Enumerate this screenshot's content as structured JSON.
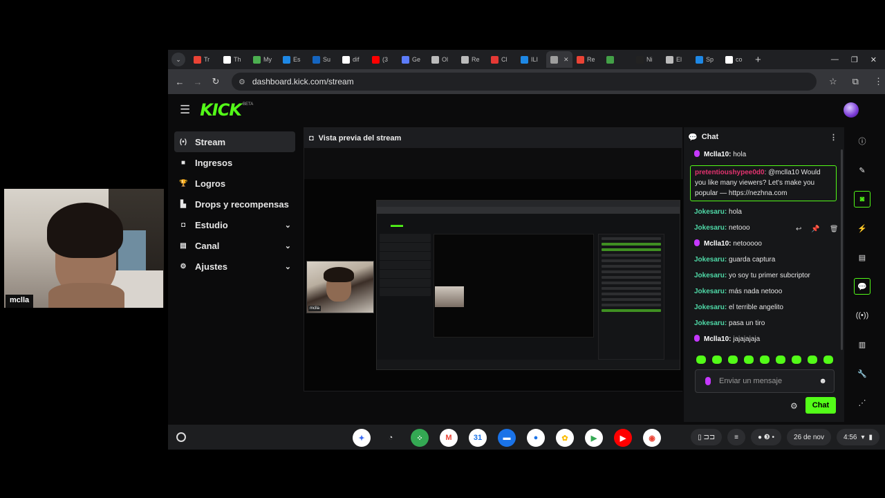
{
  "browser": {
    "tabs": [
      {
        "label": "Tr",
        "color": "#ea4335"
      },
      {
        "label": "Th",
        "color": "#ffffff"
      },
      {
        "label": "My",
        "color": "#4caf50"
      },
      {
        "label": "Es",
        "color": "#1e88e5"
      },
      {
        "label": "Su",
        "color": "#1565c0"
      },
      {
        "label": "dif",
        "color": "#ffffff"
      },
      {
        "label": "(3",
        "color": "#ff0000"
      },
      {
        "label": "Ge",
        "color": "#5c7cfa"
      },
      {
        "label": "Ol",
        "color": "#bbbbbb"
      },
      {
        "label": "Re",
        "color": "#bbbbbb"
      },
      {
        "label": "Cl",
        "color": "#e53935"
      },
      {
        "label": "ILI",
        "color": "#1e88e5"
      },
      {
        "label": "",
        "color": "#9e9e9e",
        "active": true
      },
      {
        "label": "Re",
        "color": "#ea4335"
      },
      {
        "label": "",
        "color": "#43a047"
      },
      {
        "label": "Ni",
        "color": "#222222"
      },
      {
        "label": "El",
        "color": "#bbbbbb"
      },
      {
        "label": "Sp",
        "color": "#1e88e5"
      },
      {
        "label": "co",
        "color": "#ffffff"
      }
    ],
    "url": "dashboard.kick.com/stream"
  },
  "kick": {
    "logo": "KICK",
    "beta": "BETA",
    "sidebar": [
      {
        "label": "Stream",
        "icon": "broadcast-icon",
        "glyph": "(•)",
        "active": true,
        "expandable": false
      },
      {
        "label": "Ingresos",
        "icon": "money-icon",
        "glyph": "■",
        "active": false,
        "expandable": false
      },
      {
        "label": "Logros",
        "icon": "trophy-icon",
        "glyph": "🏆",
        "active": false,
        "expandable": false
      },
      {
        "label": "Drops y recompensas",
        "icon": "drops-icon",
        "glyph": "▙",
        "active": false,
        "expandable": false
      },
      {
        "label": "Estudio",
        "icon": "studio-icon",
        "glyph": "◘",
        "active": false,
        "expandable": true
      },
      {
        "label": "Canal",
        "icon": "channel-icon",
        "glyph": "▤",
        "active": false,
        "expandable": true
      },
      {
        "label": "Ajustes",
        "icon": "settings-icon",
        "glyph": "⚙",
        "active": false,
        "expandable": true
      }
    ],
    "preview_title": "Vista previa del stream",
    "chat": {
      "title": "Chat",
      "messages": [
        {
          "user": "Mclla10:",
          "text": " hola",
          "color": "#ffffff",
          "mic": true
        },
        {
          "user": "pretentioushypee0d0",
          "text": ": @mclla10 Would you like many viewers? Let's make you popular — https://nezhna.com",
          "color": "#e3336f",
          "highlight": true
        },
        {
          "user": "Jokesaru:",
          "text": " hola",
          "color": "#4fd9a7"
        },
        {
          "user": "Jokesaru:",
          "text": " netooo",
          "color": "#4fd9a7"
        },
        {
          "user": "Mclla10:",
          "text": " netooooo",
          "color": "#ffffff",
          "mic": true
        },
        {
          "user": "Jokesaru:",
          "text": " guarda captura",
          "color": "#4fd9a7"
        },
        {
          "user": "Jokesaru:",
          "text": " yo soy tu primer subcriptor",
          "color": "#4fd9a7"
        },
        {
          "user": "Jokesaru:",
          "text": " más nada netooo",
          "color": "#4fd9a7"
        },
        {
          "user": "Jokesaru:",
          "text": " el terrible angelito",
          "color": "#4fd9a7"
        },
        {
          "user": "Jokesaru:",
          "text": " pasa un tiro",
          "color": "#4fd9a7"
        },
        {
          "user": "Mclla10:",
          "text": " jajajajaja",
          "color": "#ffffff",
          "mic": true
        }
      ],
      "input_placeholder": "Enviar un mensaje",
      "send_label": "Chat"
    },
    "rail_icons": [
      "info-icon",
      "edit-icon",
      "camera-icon",
      "bolt-icon",
      "notes-icon",
      "chat-icon",
      "signal-icon",
      "server-icon",
      "wrench-icon",
      "share-icon"
    ]
  },
  "shelf": {
    "apps": [
      {
        "name": "gemini-icon",
        "glyph": "✦",
        "bg": "#ffffff",
        "fg": "#3b6cf4"
      },
      {
        "name": "cast-icon",
        "glyph": "◔",
        "bg": "transparent",
        "fg": "#dddddd"
      },
      {
        "name": "apps-icon",
        "glyph": "⁘",
        "bg": "#34a853",
        "fg": "#ffffff"
      },
      {
        "name": "gmail-icon",
        "glyph": "M",
        "bg": "#ffffff",
        "fg": "#ea4335"
      },
      {
        "name": "calendar-icon",
        "glyph": "31",
        "bg": "#ffffff",
        "fg": "#1a73e8"
      },
      {
        "name": "files-icon",
        "glyph": "▬",
        "bg": "#1a73e8",
        "fg": "#ffffff"
      },
      {
        "name": "messages-icon",
        "glyph": "●",
        "bg": "#ffffff",
        "fg": "#1a73e8"
      },
      {
        "name": "photos-icon",
        "glyph": "✿",
        "bg": "#ffffff",
        "fg": "#fbbc04"
      },
      {
        "name": "play-store-icon",
        "glyph": "▶",
        "bg": "#ffffff",
        "fg": "#34a853"
      },
      {
        "name": "youtube-icon",
        "glyph": "▶",
        "bg": "#ff0000",
        "fg": "#ffffff"
      },
      {
        "name": "chrome-icon",
        "glyph": "◉",
        "bg": "#ffffff",
        "fg": "#ea4335"
      }
    ],
    "date": "26 de nov",
    "time": "4:56"
  },
  "webcam": {
    "label": "mclla"
  }
}
